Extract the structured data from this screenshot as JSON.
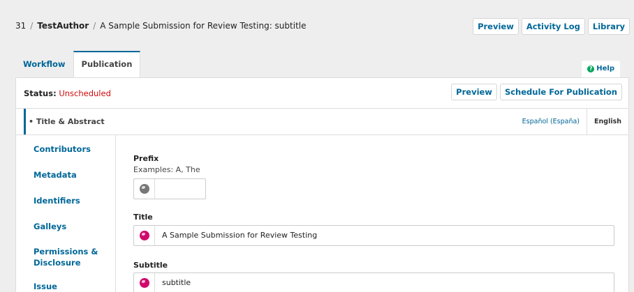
{
  "header": {
    "submission_id": "31",
    "separator": "/",
    "author": "TestAuthor",
    "title": "A Sample Submission for Review Testing: subtitle",
    "buttons": {
      "preview": "Preview",
      "activity_log": "Activity Log",
      "library": "Library"
    }
  },
  "tabs": {
    "workflow": "Workflow",
    "publication": "Publication"
  },
  "help": {
    "icon": "question-circle-icon",
    "label": "Help"
  },
  "status": {
    "label": "Status:",
    "value": "Unscheduled",
    "preview": "Preview",
    "schedule": "Schedule For Publication"
  },
  "section": {
    "title": "• Title & Abstract",
    "languages": {
      "spanish": "Español (España)",
      "english": "English"
    }
  },
  "sidenav": {
    "contributors": "Contributors",
    "metadata": "Metadata",
    "identifiers": "Identifiers",
    "galleys": "Galleys",
    "permissions_1": "Permissions &",
    "permissions_2": "Disclosure",
    "issue": "Issue"
  },
  "form": {
    "prefix": {
      "label": "Prefix",
      "description": "Examples: A, The",
      "value": ""
    },
    "title": {
      "label": "Title",
      "value": "A Sample Submission for Review Testing"
    },
    "subtitle": {
      "label": "Subtitle",
      "value": "subtitle"
    }
  },
  "colors": {
    "accent": "#006798",
    "status_red": "#d00a0a",
    "globe_pink": "#d00a6c",
    "help_green": "#00a65a"
  }
}
